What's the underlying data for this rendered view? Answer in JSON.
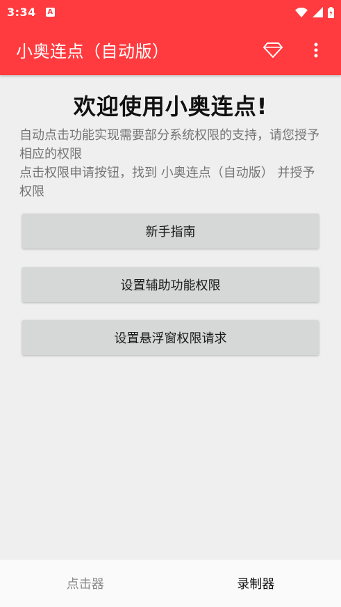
{
  "status_bar": {
    "time": "3:34",
    "notification_icon": "a-notification-icon"
  },
  "app_bar": {
    "title": "小奥连点（自动版）",
    "actions": [
      "diamond-icon",
      "more-vert-icon"
    ]
  },
  "main": {
    "welcome": "欢迎使用小奥连点!",
    "description_line1": "自动点击功能实现需要部分系统权限的支持，请您授予相应的权限",
    "description_line2": "点击权限申请按钮，找到 小奥连点（自动版） 并授予权限",
    "buttons": [
      {
        "label": "新手指南"
      },
      {
        "label": "设置辅助功能权限"
      },
      {
        "label": "设置悬浮窗权限请求"
      }
    ]
  },
  "bottom_nav": {
    "tabs": [
      {
        "label": "点击器"
      },
      {
        "label": "录制器"
      }
    ]
  },
  "colors": {
    "accent": "#ff3b3f",
    "background": "#efefef",
    "button": "#d6d7d7"
  }
}
